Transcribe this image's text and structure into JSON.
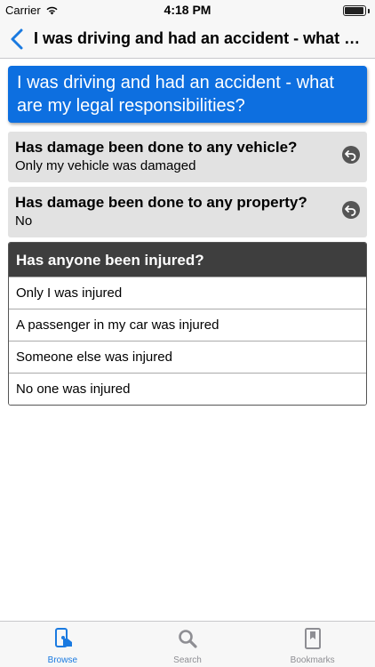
{
  "status_bar": {
    "carrier": "Carrier",
    "time": "4:18 PM",
    "battery_level": 0.95
  },
  "nav": {
    "title": "I was driving and had an accident - what are..."
  },
  "question": {
    "text": "I was driving and had an accident - what are my legal responsibilities?"
  },
  "answered": [
    {
      "question": "Has damage been done to any vehicle?",
      "answer": "Only my vehicle was damaged"
    },
    {
      "question": "Has damage been done to any property?",
      "answer": "No"
    }
  ],
  "current": {
    "question": "Has anyone been injured?",
    "options": [
      "Only I was injured",
      "A passenger in my car was injured",
      "Someone else was injured",
      "No one was injured"
    ]
  },
  "tabs": [
    {
      "label": "Browse",
      "icon": "browse-icon",
      "active": true
    },
    {
      "label": "Search",
      "icon": "search-icon",
      "active": false
    },
    {
      "label": "Bookmarks",
      "icon": "bookmark-icon",
      "active": false
    }
  ],
  "colors": {
    "accent": "#0d6fe0",
    "tab_active": "#1a7ae0",
    "tab_inactive": "#8e8e93"
  }
}
